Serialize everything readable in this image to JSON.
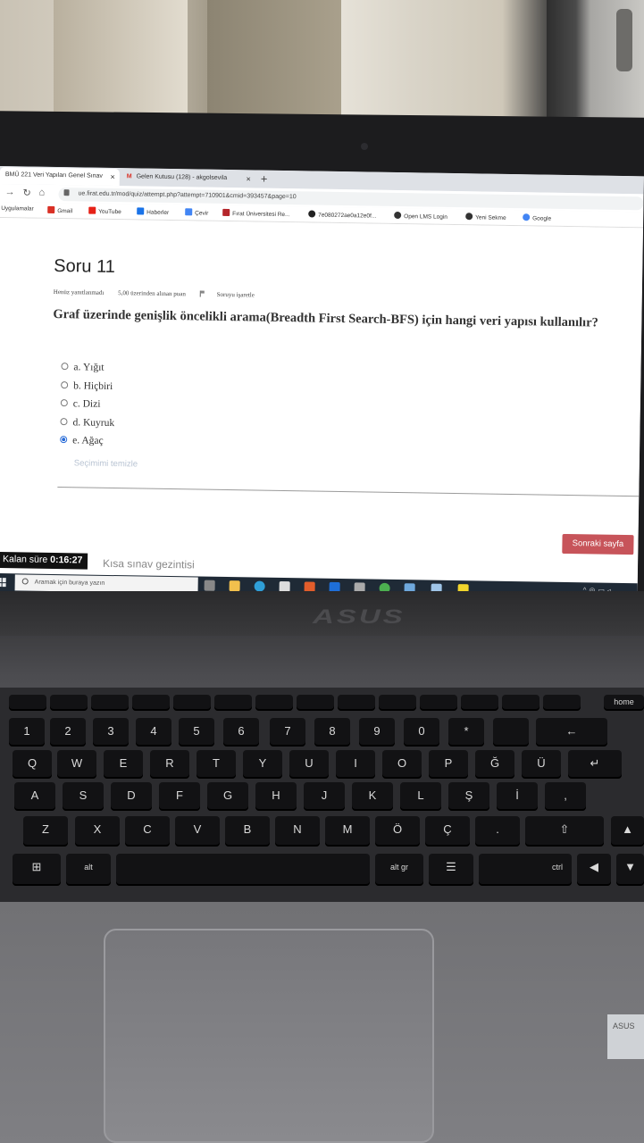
{
  "browser": {
    "tabs": [
      {
        "label": "BMÜ 221 Veri Yapıları Genel Sınav",
        "active": true
      },
      {
        "label": "Gelen Kutusu (128) - akgolsevila",
        "active": false
      }
    ],
    "url": "ue.firat.edu.tr/mod/quiz/attempt.php?attempt=710901&cmid=393457&page=10",
    "bookmarks": [
      "Uygulamalar",
      "Gmail",
      "YouTube",
      "Haberler",
      "Çevir",
      "Fırat Üniversitesi Re...",
      "7e080272ae0a12e0f...",
      "Open LMS Login",
      "Yeni Sekme",
      "Google"
    ]
  },
  "quiz": {
    "title": "Soru 11",
    "status": "Henüz yanıtlanmadı",
    "points": "5,00 üzerinden alınan puan",
    "flag_label": "Soruyu işaretle",
    "question": "Graf üzerinde genişlik öncelikli arama(Breadth First Search-BFS) için hangi veri yapısı kullanılır?",
    "options": [
      {
        "label": "a. Yığıt",
        "selected": false
      },
      {
        "label": "b. Hiçbiri",
        "selected": false
      },
      {
        "label": "c. Dizi",
        "selected": false
      },
      {
        "label": "d. Kuyruk",
        "selected": false
      },
      {
        "label": "e. Ağaç",
        "selected": true
      }
    ],
    "clear_choice": "Seçimimi temizle",
    "next_button": "Sonraki sayfa",
    "timer_label": "Kalan süre",
    "timer_value": "0:16:27",
    "nav_label": "Kısa sınav gezintisi"
  },
  "taskbar": {
    "search_placeholder": "Aramak için buraya yazın"
  },
  "laptop": {
    "brand": "ASUS",
    "sticker": "ASUS"
  },
  "keyboard": {
    "row1": [
      "1",
      "2",
      "3",
      "4",
      "5",
      "6",
      "7",
      "8",
      "9",
      "0"
    ],
    "row2": [
      "Q",
      "W",
      "E",
      "R",
      "T",
      "Y",
      "U",
      "I",
      "O",
      "P",
      "Ğ",
      "Ü"
    ],
    "row3": [
      "A",
      "S",
      "D",
      "F",
      "G",
      "H",
      "J",
      "K",
      "L",
      "Ş",
      "İ"
    ],
    "row4": [
      "Z",
      "X",
      "C",
      "V",
      "B",
      "N",
      "M",
      "Ö",
      "Ç"
    ],
    "alt": "alt",
    "altgr": "alt gr",
    "ctrl": "ctrl",
    "home": "home"
  },
  "colors": {
    "next_button": "#c7545a",
    "radio_selected": "#2a6dd8",
    "taskbar": "#1f2a36"
  }
}
